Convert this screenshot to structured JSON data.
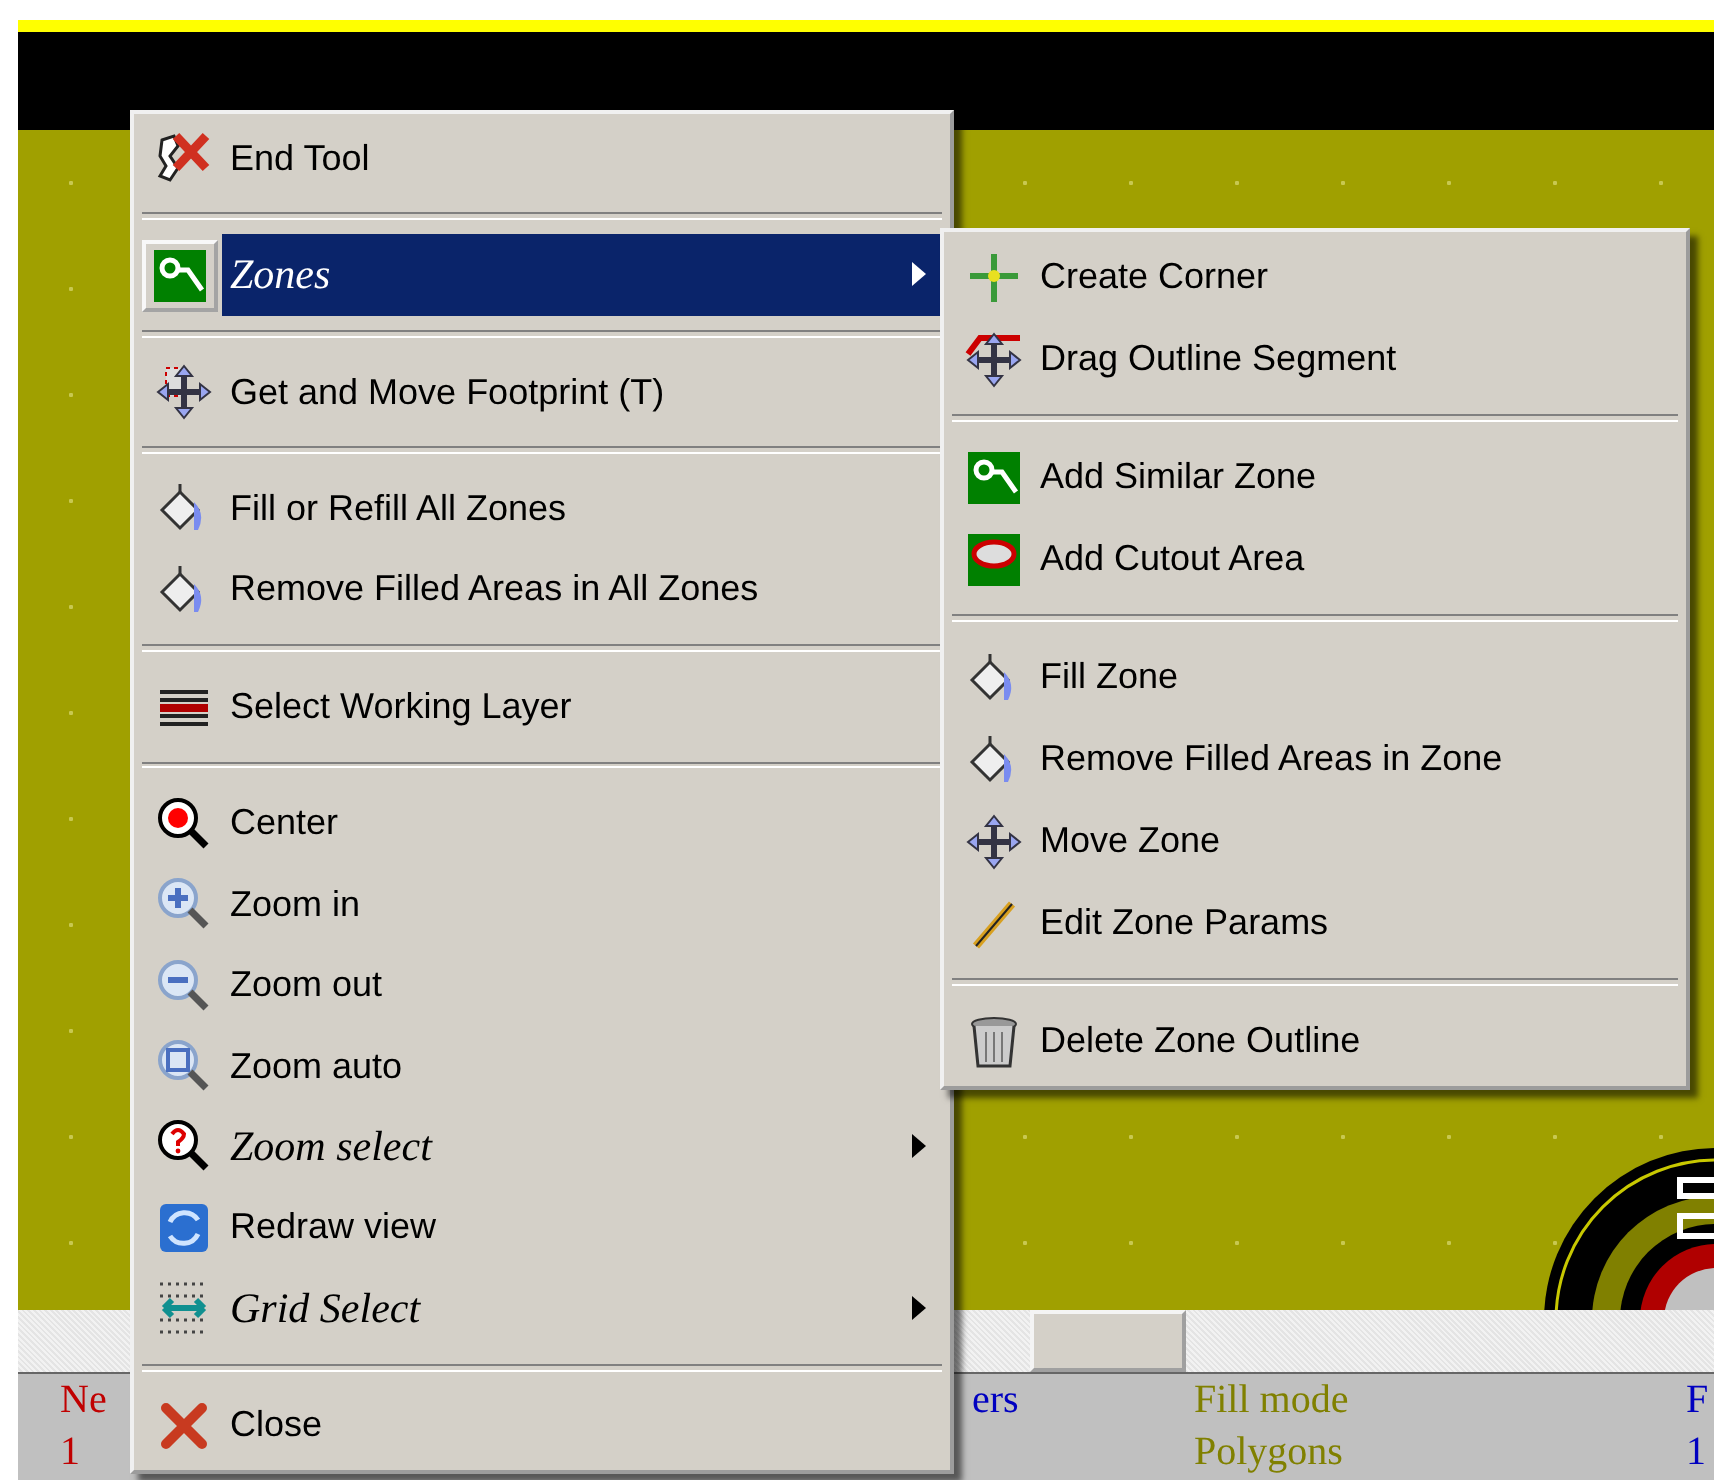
{
  "menu": {
    "items": [
      {
        "kind": "item",
        "label": "End Tool",
        "italic": false,
        "submenu": false,
        "selected": false
      },
      {
        "kind": "separator"
      },
      {
        "kind": "item",
        "label": "Zones",
        "italic": true,
        "submenu": true,
        "selected": true
      },
      {
        "kind": "separator"
      },
      {
        "kind": "item",
        "label": "Get and Move Footprint (T)",
        "italic": false,
        "submenu": false,
        "selected": false
      },
      {
        "kind": "separator"
      },
      {
        "kind": "item",
        "label": "Fill or Refill All Zones",
        "italic": false,
        "submenu": false,
        "selected": false
      },
      {
        "kind": "item",
        "label": "Remove Filled Areas in All Zones",
        "italic": false,
        "submenu": false,
        "selected": false
      },
      {
        "kind": "separator"
      },
      {
        "kind": "item",
        "label": "Select Working Layer",
        "italic": false,
        "submenu": false,
        "selected": false
      },
      {
        "kind": "separator"
      },
      {
        "kind": "item",
        "label": "Center",
        "italic": false,
        "submenu": false,
        "selected": false
      },
      {
        "kind": "item",
        "label": "Zoom in",
        "italic": false,
        "submenu": false,
        "selected": false
      },
      {
        "kind": "item",
        "label": "Zoom out",
        "italic": false,
        "submenu": false,
        "selected": false
      },
      {
        "kind": "item",
        "label": "Zoom auto",
        "italic": false,
        "submenu": false,
        "selected": false
      },
      {
        "kind": "item",
        "label": "Zoom select",
        "italic": true,
        "submenu": true,
        "selected": false
      },
      {
        "kind": "item",
        "label": "Redraw view",
        "italic": false,
        "submenu": false,
        "selected": false
      },
      {
        "kind": "item",
        "label": "Grid Select",
        "italic": true,
        "submenu": true,
        "selected": false
      },
      {
        "kind": "separator"
      },
      {
        "kind": "item",
        "label": "Close",
        "italic": false,
        "submenu": false,
        "selected": false
      }
    ]
  },
  "submenu": {
    "items": [
      {
        "kind": "item",
        "label": "Create Corner",
        "selected": false
      },
      {
        "kind": "item",
        "label": "Drag Outline Segment",
        "selected": false
      },
      {
        "kind": "separator"
      },
      {
        "kind": "item",
        "label": "Add Similar Zone",
        "selected": false
      },
      {
        "kind": "item",
        "label": "Add Cutout Area",
        "selected": false
      },
      {
        "kind": "separator"
      },
      {
        "kind": "item",
        "label": "Fill Zone",
        "selected": false
      },
      {
        "kind": "item",
        "label": "Remove Filled Areas in Zone",
        "selected": false
      },
      {
        "kind": "item",
        "label": "Move Zone",
        "selected": false
      },
      {
        "kind": "item",
        "label": "Edit Zone Params",
        "selected": false
      },
      {
        "kind": "separator"
      },
      {
        "kind": "item",
        "label": "Delete Zone Outline",
        "selected": false
      }
    ]
  },
  "status_bar": [
    {
      "label": "Ne",
      "value": "1",
      "color": "#c00000"
    },
    {
      "label": "ers",
      "color": "#0000c0"
    },
    {
      "label": "Fill mode",
      "value": "Polygons",
      "color": "#808000"
    },
    {
      "label": "F",
      "value": "1",
      "color": "#0000c0"
    }
  ]
}
